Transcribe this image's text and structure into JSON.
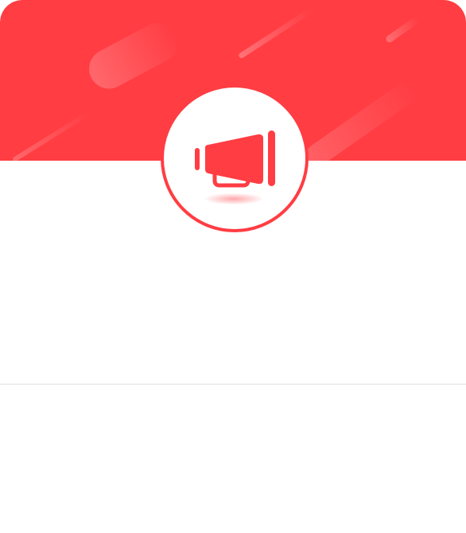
{
  "dialog": {
    "header": {
      "background_color": "#ff3d43",
      "icon": "megaphone-icon",
      "accent_color": "#ff3d43"
    },
    "content": {
      "text": ""
    },
    "footer": {
      "text": ""
    },
    "divider_color": "#eeeeee"
  }
}
